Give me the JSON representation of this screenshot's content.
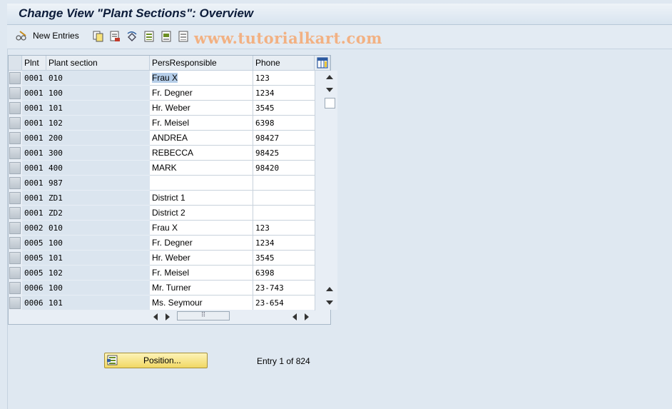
{
  "title": "Change View \"Plant Sections\": Overview",
  "toolbar": {
    "new_entries_label": "New Entries"
  },
  "watermark": "www.tutorialkart.com",
  "table": {
    "headers": [
      "Plnt",
      "Plant section",
      "PersResponsible",
      "Phone"
    ],
    "rows": [
      {
        "plnt": "0001",
        "section": "010",
        "person": "Frau X",
        "phone": "123"
      },
      {
        "plnt": "0001",
        "section": "100",
        "person": "Fr. Degner",
        "phone": "1234"
      },
      {
        "plnt": "0001",
        "section": "101",
        "person": "Hr. Weber",
        "phone": "3545"
      },
      {
        "plnt": "0001",
        "section": "102",
        "person": "Fr. Meisel",
        "phone": "6398"
      },
      {
        "plnt": "0001",
        "section": "200",
        "person": "ANDREA",
        "phone": "98427"
      },
      {
        "plnt": "0001",
        "section": "300",
        "person": "REBECCA",
        "phone": "98425"
      },
      {
        "plnt": "0001",
        "section": "400",
        "person": "MARK",
        "phone": "98420"
      },
      {
        "plnt": "0001",
        "section": "987",
        "person": "",
        "phone": ""
      },
      {
        "plnt": "0001",
        "section": "ZD1",
        "person": "District 1",
        "phone": ""
      },
      {
        "plnt": "0001",
        "section": "ZD2",
        "person": "District 2",
        "phone": ""
      },
      {
        "plnt": "0002",
        "section": "010",
        "person": "Frau X",
        "phone": "123"
      },
      {
        "plnt": "0005",
        "section": "100",
        "person": "Fr. Degner",
        "phone": "1234"
      },
      {
        "plnt": "0005",
        "section": "101",
        "person": "Hr. Weber",
        "phone": "3545"
      },
      {
        "plnt": "0005",
        "section": "102",
        "person": "Fr. Meisel",
        "phone": "6398"
      },
      {
        "plnt": "0006",
        "section": "100",
        "person": "Mr. Turner",
        "phone": "23-743"
      },
      {
        "plnt": "0006",
        "section": "101",
        "person": "Ms. Seymour",
        "phone": "23-654"
      }
    ]
  },
  "position_button": {
    "label": "Position..."
  },
  "entry_info": "Entry 1 of 824"
}
